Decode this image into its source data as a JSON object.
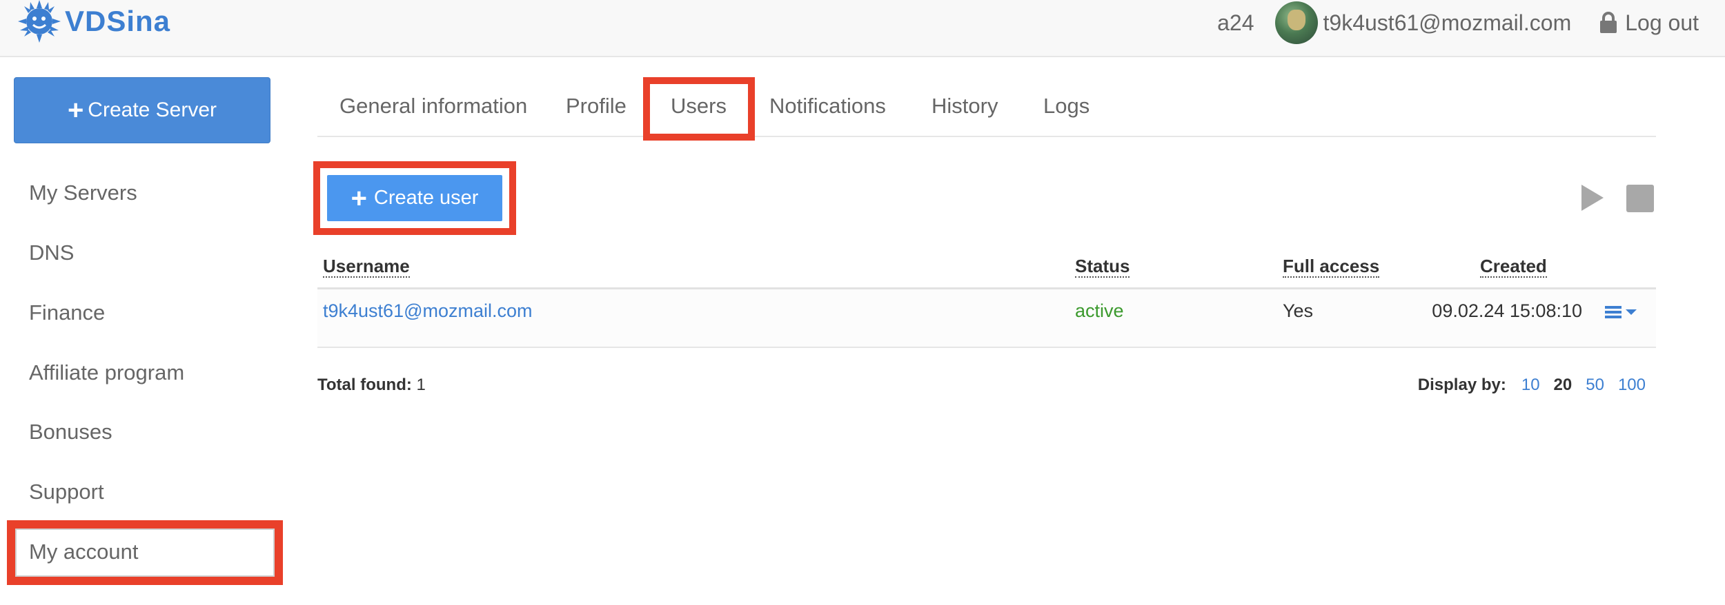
{
  "header": {
    "logo_text": "VDSina",
    "tariff": "a24",
    "user_email": "t9k4ust61@mozmail.com",
    "logout_label": "Log out"
  },
  "sidebar": {
    "create_server_label": "Create Server",
    "items": [
      {
        "label": "My Servers"
      },
      {
        "label": "DNS"
      },
      {
        "label": "Finance"
      },
      {
        "label": "Affiliate program"
      },
      {
        "label": "Bonuses"
      },
      {
        "label": "Support"
      },
      {
        "label": "My account"
      }
    ]
  },
  "tabs": [
    {
      "label": "General information"
    },
    {
      "label": "Profile"
    },
    {
      "label": "Users"
    },
    {
      "label": "Notifications"
    },
    {
      "label": "History"
    },
    {
      "label": "Logs"
    }
  ],
  "toolbar": {
    "create_user_label": "Create user"
  },
  "table": {
    "columns": [
      "Username",
      "Status",
      "Full access",
      "Created"
    ],
    "rows": [
      {
        "username": "t9k4ust61@mozmail.com",
        "status": "active",
        "full_access": "Yes",
        "created": "09.02.24 15:08:10"
      }
    ]
  },
  "footer": {
    "total_label": "Total found:",
    "total_value": "1",
    "display_by_label": "Display by:",
    "display_by_options": [
      "10",
      "20",
      "50",
      "100"
    ],
    "display_by_selected": "20"
  },
  "colors": {
    "brand": "#3d7fd1",
    "create_server_button": "#4a8ad8",
    "create_user_button": "#4b97ef",
    "status_active": "#3c9a2e",
    "highlight": "#e9402a"
  },
  "icons": {
    "logo": "sun-mascot-icon",
    "logout": "lock-icon",
    "start": "play-icon",
    "stop": "stop-icon",
    "row_menu": "menu-icon"
  }
}
